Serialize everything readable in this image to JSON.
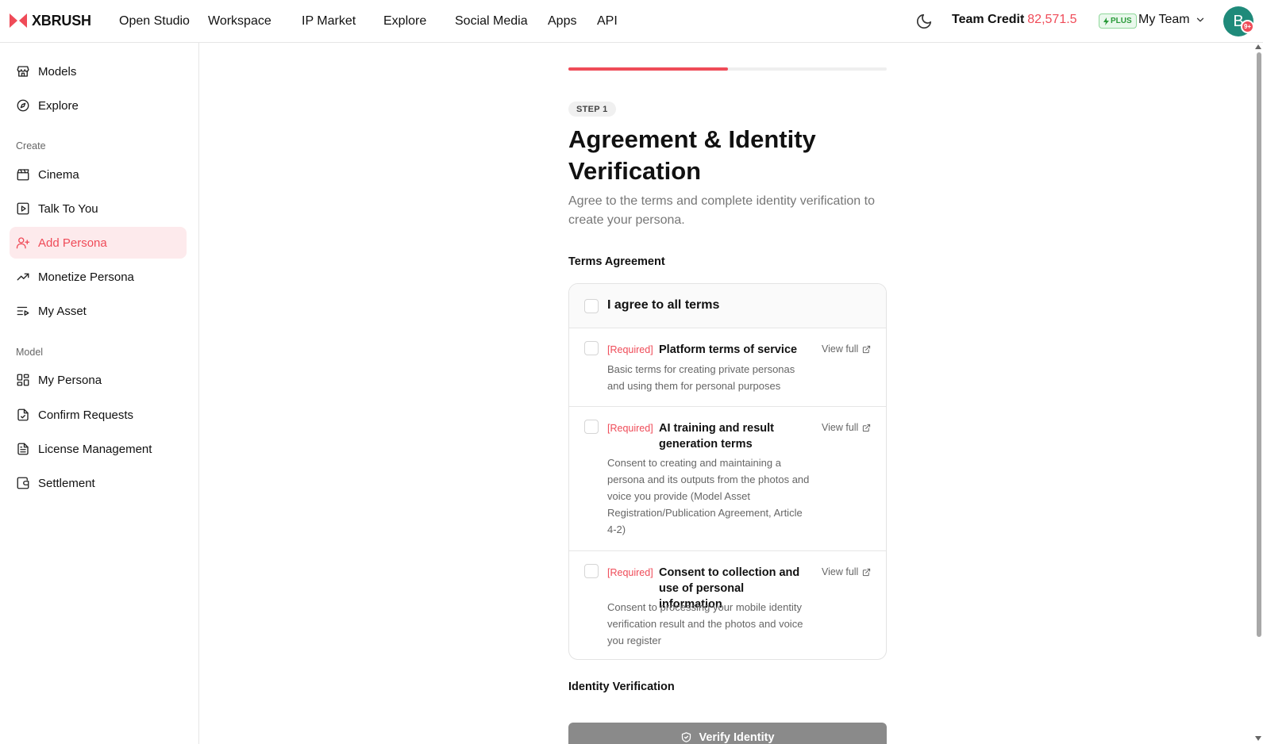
{
  "header": {
    "logo_text": "XBRUSH",
    "nav": [
      "Open Studio",
      "Workspace",
      "IP Market",
      "Explore",
      "Social Media",
      "Apps",
      "API"
    ],
    "team_credit_label": "Team Credit",
    "team_credit_value": "82,571.5",
    "plan_badge": "PLUS",
    "team_name": "My Team",
    "avatar_initial": "B",
    "notification_badge": "9+"
  },
  "sidebar": {
    "top_items": [
      {
        "label": "Models",
        "icon": "store-icon"
      },
      {
        "label": "Explore",
        "icon": "compass-icon"
      }
    ],
    "create_section": "Create",
    "create_items": [
      {
        "label": "Cinema",
        "icon": "clapperboard-icon"
      },
      {
        "label": "Talk To You",
        "icon": "play-square-icon"
      },
      {
        "label": "Add Persona",
        "icon": "user-plus-icon",
        "active": true
      },
      {
        "label": "Monetize Persona",
        "icon": "trending-up-icon"
      },
      {
        "label": "My Asset",
        "icon": "list-video-icon"
      }
    ],
    "model_section": "Model",
    "model_items": [
      {
        "label": "My Persona",
        "icon": "layout-grid-icon"
      },
      {
        "label": "Confirm Requests",
        "icon": "file-check-icon"
      },
      {
        "label": "License Management",
        "icon": "file-text-icon"
      },
      {
        "label": "Settlement",
        "icon": "wallet-icon"
      }
    ]
  },
  "main": {
    "progress_fraction": 0.5,
    "step_label": "STEP 1",
    "title": "Agreement & Identity Verification",
    "subtitle": "Agree to the terms and complete identity verification to create your persona.",
    "terms_heading": "Terms Agreement",
    "agree_all": "I agree to all terms",
    "terms": [
      {
        "required": "[Required]",
        "title": "Platform terms of service",
        "view": "View full",
        "description": "Basic terms for creating private personas and using them for personal purposes"
      },
      {
        "required": "[Required]",
        "title": "AI training and result generation terms",
        "view": "View full",
        "description": "Consent to creating and maintaining a persona and its outputs from the photos and voice you provide (Model Asset Registration/Publication Agreement, Article 4-2)"
      },
      {
        "required": "[Required]",
        "title": "Consent to collection and use of personal information",
        "view": "View full",
        "description": "Consent to processing your mobile identity verification result and the photos and voice you register"
      }
    ],
    "identity_heading": "Identity Verification",
    "verify_button": "Verify Identity"
  },
  "colors": {
    "accent": "#ef4b58",
    "active_bg": "#fdeaec",
    "disabled_button": "#8a8a8a",
    "plus_badge_green": "#2a9a3a",
    "avatar_teal": "#1f8a7a"
  }
}
